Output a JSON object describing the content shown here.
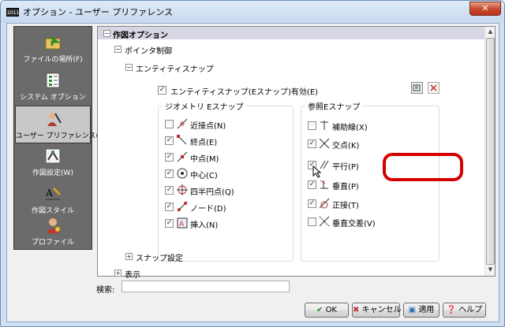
{
  "window": {
    "title": "オプション - ユーザー プリファレンス",
    "app_badge": "2011",
    "close_glyph": "✕"
  },
  "sidebar": {
    "items": [
      {
        "label": "ファイルの場所(F)",
        "icon": "folder-arrow-icon"
      },
      {
        "label": "システム オプション",
        "icon": "system-checklist-icon"
      },
      {
        "label": "ユーザー プリファレンス(U)",
        "icon": "user-preferences-icon",
        "active": true
      },
      {
        "label": "作図設定(W)",
        "icon": "drafting-settings-icon"
      },
      {
        "label": "作図スタイル",
        "icon": "drafting-style-icon"
      },
      {
        "label": "プロファイル",
        "icon": "profile-icon"
      }
    ]
  },
  "tree": {
    "root": "作図オプション",
    "pointer": "ポインタ制御",
    "esnap": "エンティティスナップ",
    "esnap_enable": "エンティティスナップ(Eスナップ)有効(E)",
    "snap_settings": "スナップ設定",
    "display": "表示"
  },
  "geometry": {
    "title": "ジオメトリ Eスナップ",
    "items": [
      {
        "label": "近接点(N)",
        "checked": false
      },
      {
        "label": "終点(E)",
        "checked": true
      },
      {
        "label": "中点(M)",
        "checked": true
      },
      {
        "label": "中心(C)",
        "checked": true
      },
      {
        "label": "四半円点(Q)",
        "checked": true
      },
      {
        "label": "ノード(D)",
        "checked": true
      },
      {
        "label": "挿入(N)",
        "checked": true
      }
    ]
  },
  "reference": {
    "title": "参照Eスナップ",
    "items": [
      {
        "label": "補助線(X)",
        "checked": false
      },
      {
        "label": "交点(K)",
        "checked": true
      },
      {
        "label": "平行(P)",
        "checked": true
      },
      {
        "label": "垂直(P)",
        "checked": true
      },
      {
        "label": "正接(T)",
        "checked": true
      },
      {
        "label": "垂直交差(V)",
        "checked": false
      }
    ]
  },
  "search": {
    "label": "検索:",
    "value": ""
  },
  "buttons": {
    "ok": "OK",
    "cancel": "キャンセル",
    "apply": "適用",
    "help": "ヘルプ"
  },
  "colors": {
    "highlight": "#d40000",
    "header": "#d7d7e4"
  }
}
